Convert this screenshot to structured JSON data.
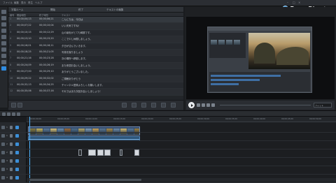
{
  "app": {
    "brand": "PowerDirector",
    "window_controls": [
      "–",
      "□",
      "×"
    ]
  },
  "menubar": {
    "items": [
      "ファイル",
      "編集",
      "表示",
      "再生",
      "ヘルプ"
    ]
  },
  "subtitle_room": {
    "header_labels": [
      "字幕ルーム",
      "開始",
      "終了",
      "テキストの編集"
    ],
    "column_headers": [
      "番号",
      "開始時間",
      "終了時間",
      "テキスト"
    ],
    "rows": [
      {
        "no": "1",
        "start": "00;00;04;13",
        "end": "00;00;06;21",
        "text": "こんにちは、今日は"
      },
      {
        "no": "2",
        "start": "00;00;07;22",
        "end": "00;00;10;04",
        "text": "いい天気ですね！"
      },
      {
        "no": "3",
        "start": "00;00;10;15",
        "end": "00;00;12;29",
        "text": "山の景色がとても綺麗です。"
      },
      {
        "no": "4",
        "start": "00;00;13;10",
        "end": "00;00;15;20",
        "text": "ここで少し休憩しましょう。"
      },
      {
        "no": "5",
        "start": "00;00;16;01",
        "end": "00;00;18;11",
        "text": "夕日が沈んでいきます。"
      },
      {
        "no": "6",
        "start": "00;00;18;25",
        "end": "00;00;21;05",
        "text": "写真を撮りましょう"
      },
      {
        "no": "7",
        "start": "00;00;21;16",
        "end": "00;00;23;28",
        "text": "次の場所へ移動します。"
      },
      {
        "no": "8",
        "start": "00;00;24;09",
        "end": "00;00;26;19",
        "text": "また来週お会いしましょう。"
      },
      {
        "no": "9",
        "start": "00;00;27;00",
        "end": "00;00;29;10",
        "text": "ありがとうございました。"
      },
      {
        "no": "10",
        "start": "00;00;29;22",
        "end": "00;00;32;02",
        "text": "ご視聴ありがとう"
      },
      {
        "no": "11",
        "start": "00;00;32;13",
        "end": "00;00;34;25",
        "text": "チャンネル登録よろしくお願いします。"
      },
      {
        "no": "12",
        "start": "00;00;35;06",
        "end": "00;00;37;16",
        "text": "それではまた次回お会いしましょう！"
      }
    ]
  },
  "preview": {
    "zoom_label": "フィット"
  },
  "timeline": {
    "ruler_ticks": [
      "00;00;00;00",
      "00;00;05;00",
      "00;00;10;00",
      "00;00;15;00",
      "00;00;20;00",
      "00;00;25;00",
      "00;00;30;00",
      "00;00;35;00",
      "00;00;40;00",
      "00;00;45;00",
      "00;00;50;00"
    ],
    "track_labels": [
      "1",
      "1",
      "2",
      "2",
      "3",
      "3",
      "4"
    ]
  },
  "colors": {
    "accent": "#2f8be0",
    "playhead": "#4fb3ff",
    "clip_video": "#334a6a",
    "clip_audio": "#2c5478"
  }
}
